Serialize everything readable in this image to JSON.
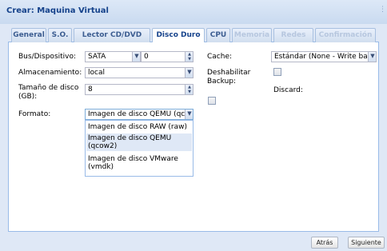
{
  "window": {
    "title": "Crear: Maquina Virtual"
  },
  "tabs": [
    {
      "label": "General",
      "state": "normal"
    },
    {
      "label": "S.O.",
      "state": "normal"
    },
    {
      "label": "Lector CD/DVD",
      "state": "normal"
    },
    {
      "label": "Disco Duro",
      "state": "active"
    },
    {
      "label": "CPU",
      "state": "normal"
    },
    {
      "label": "Memoria",
      "state": "disabled"
    },
    {
      "label": "Redes",
      "state": "disabled"
    },
    {
      "label": "Confirmación",
      "state": "disabled"
    }
  ],
  "form": {
    "bus_label": "Bus/Dispositivo:",
    "bus_value": "SATA",
    "bus_index": "0",
    "storage_label": "Almacenamiento:",
    "storage_value": "local",
    "size_label": "Tamaño de disco (GB):",
    "size_value": "8",
    "format_label": "Formato:",
    "format_value": "Imagen de disco QEMU (qc",
    "cache_label": "Cache:",
    "cache_value": "Estándar (None - Write bac",
    "backup_label": "Deshabilitar Backup:",
    "discard_label": "Discard:"
  },
  "format_options": [
    {
      "label": "Imagen de disco RAW (raw)",
      "highlighted": false
    },
    {
      "label": "Imagen de disco QEMU (qcow2)",
      "highlighted": true
    },
    {
      "label": "Imagen de disco VMware (vmdk)",
      "highlighted": false
    }
  ],
  "footer": {
    "back_label": "Atrás",
    "next_label": "Siguiente"
  },
  "colors": {
    "title": "#15428b",
    "frame": "#dfe8f6",
    "border": "#99bbe8"
  }
}
